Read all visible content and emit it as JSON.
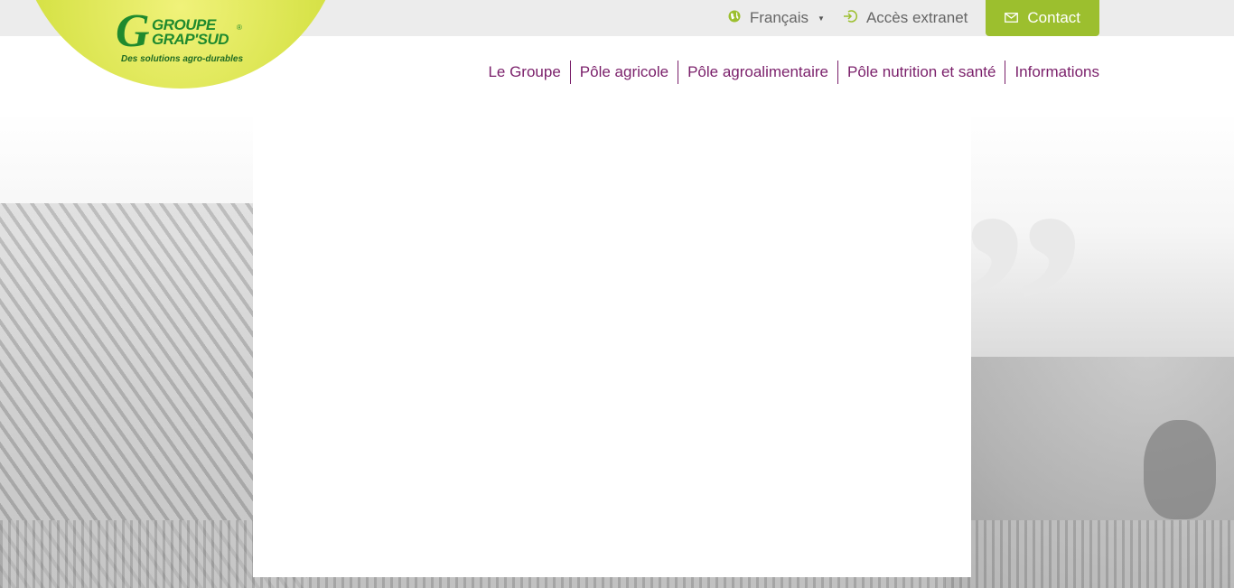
{
  "logo": {
    "line1": "GROUPE",
    "line2": "GRAP'SUD",
    "letter": "G",
    "registered": "®",
    "tagline": "Des solutions agro-durables"
  },
  "topbar": {
    "language": {
      "icon": "globe-icon",
      "label": "Français"
    },
    "extranet": {
      "icon": "login-icon",
      "label": "Accès extranet"
    },
    "contact": {
      "icon": "envelope-icon",
      "label": "Contact"
    }
  },
  "nav": {
    "items": [
      {
        "label": "Le Groupe"
      },
      {
        "label": "Pôle agricole"
      },
      {
        "label": "Pôle agroalimentaire"
      },
      {
        "label": "Pôle nutrition et santé"
      },
      {
        "label": "Informations"
      }
    ]
  },
  "hero": {
    "quote_glyph": "”"
  },
  "colors": {
    "accent_green": "#9cbf2e",
    "nav_purple": "#7a1f6a",
    "logo_green": "#1f8a2e"
  }
}
